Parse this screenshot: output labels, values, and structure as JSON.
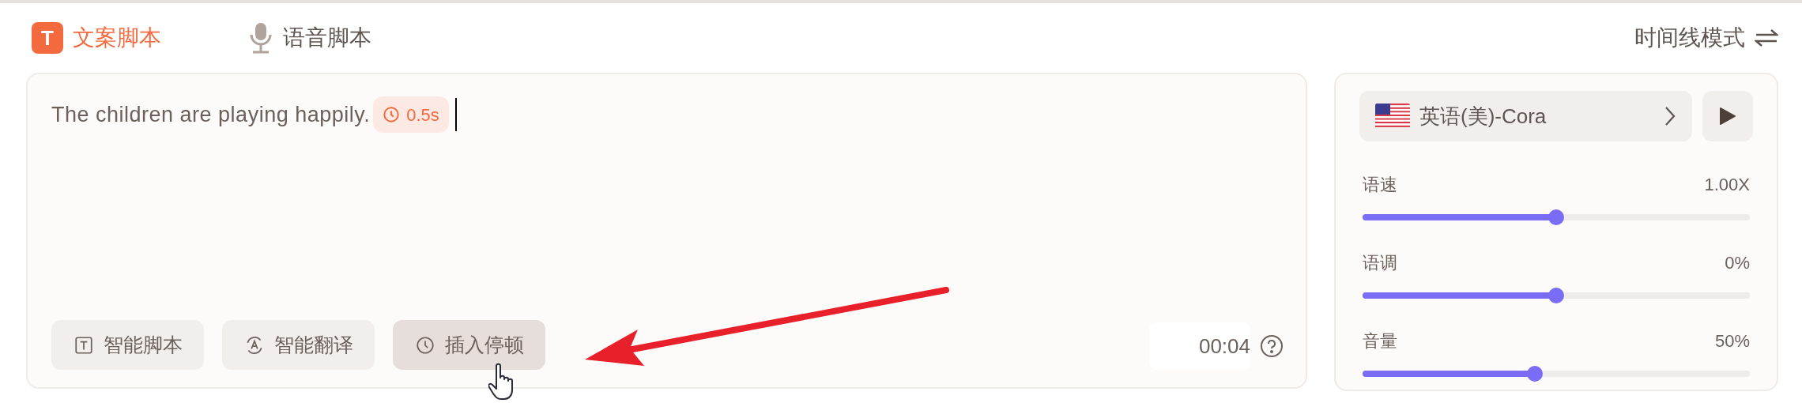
{
  "tabs": [
    {
      "label": "文案脚本",
      "icon_text": "T",
      "kind": "text",
      "selected": true
    },
    {
      "label": "语音脚本",
      "kind": "voice",
      "selected": false
    }
  ],
  "mode_toggle": {
    "label": "时间线模式"
  },
  "editor": {
    "text": "The children are playing happily.",
    "pause_badge": "0.5s",
    "tools": [
      {
        "label": "智能脚本",
        "kind": "script",
        "highlighted": false
      },
      {
        "label": "智能翻译",
        "kind": "translate",
        "highlighted": false
      },
      {
        "label": "插入停顿",
        "kind": "pause",
        "highlighted": true
      }
    ],
    "duration": "00:04"
  },
  "voice_panel": {
    "voice": "英语(美)-Cora",
    "sliders": [
      {
        "label": "语速",
        "reading": "1.00X",
        "level": 0.5
      },
      {
        "label": "语调",
        "reading": "0%",
        "level": 0.5
      },
      {
        "label": "音量",
        "reading": "50%",
        "level": 0.445
      }
    ]
  }
}
